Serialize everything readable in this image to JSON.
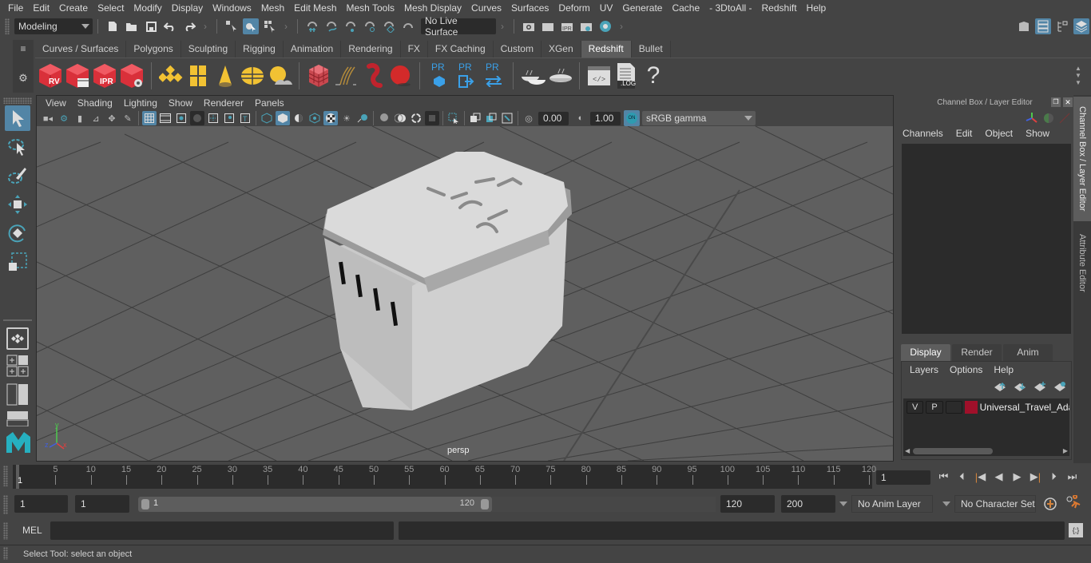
{
  "menubar": {
    "items": [
      "File",
      "Edit",
      "Create",
      "Select",
      "Modify",
      "Display",
      "Windows",
      "Mesh",
      "Edit Mesh",
      "Mesh Tools",
      "Mesh Display",
      "Curves",
      "Surfaces",
      "Deform",
      "UV",
      "Generate",
      "Cache",
      "- 3DtoAll -",
      "Redshift",
      "Help"
    ]
  },
  "statusline": {
    "mode": "Modeling",
    "live_surface": "No Live Surface",
    "icons": [
      "new-scene",
      "open-scene",
      "save-scene",
      "undo",
      "redo",
      "select-by-hierarchy",
      "select-by-object",
      "select-by-component",
      "snap-grid",
      "snap-curve",
      "snap-point",
      "snap-projected-center",
      "snap-view-plane",
      "make-live",
      "render-view",
      "render-current",
      "ipr-render",
      "render-settings",
      "hypershade"
    ],
    "right_icons": [
      "modeling-toolkit",
      "attribute-editor-toggle",
      "tool-settings-toggle",
      "channel-box-toggle"
    ]
  },
  "shelf": {
    "tabs": [
      "Curves / Surfaces",
      "Polygons",
      "Sculpting",
      "Rigging",
      "Animation",
      "Rendering",
      "FX",
      "FX Caching",
      "Custom",
      "XGen",
      "Redshift",
      "Bullet"
    ],
    "active_tab": "Redshift",
    "icons": [
      {
        "name": "redshift-render-view",
        "label": "RV"
      },
      {
        "name": "redshift-batch-render",
        "label": ""
      },
      {
        "name": "redshift-ipr",
        "label": "IPR"
      },
      {
        "name": "redshift-render-settings",
        "label": ""
      },
      {
        "name": "redshift-dome-light",
        "label": ""
      },
      {
        "name": "redshift-area-light",
        "label": ""
      },
      {
        "name": "redshift-spot-light",
        "label": ""
      },
      {
        "name": "redshift-portal-light",
        "label": ""
      },
      {
        "name": "redshift-sun-sky",
        "label": ""
      },
      {
        "name": "redshift-proxy",
        "label": ""
      },
      {
        "name": "redshift-hair",
        "label": ""
      },
      {
        "name": "redshift-volume",
        "label": ""
      },
      {
        "name": "redshift-sphere",
        "label": ""
      },
      {
        "name": "redshift-pr-mesh",
        "label": "PR"
      },
      {
        "name": "redshift-pr-export",
        "label": "PR"
      },
      {
        "name": "redshift-pr-convert",
        "label": "PR"
      },
      {
        "name": "redshift-bake-sets",
        "label": ""
      },
      {
        "name": "redshift-bake",
        "label": ""
      },
      {
        "name": "redshift-script-editor",
        "label": ""
      },
      {
        "name": "redshift-log",
        "label": ".LOG"
      },
      {
        "name": "redshift-help",
        "label": "?"
      }
    ]
  },
  "viewport": {
    "menu": [
      "View",
      "Shading",
      "Lighting",
      "Show",
      "Renderer",
      "Panels"
    ],
    "exposure": "0.00",
    "gamma": "1.00",
    "color_management": "ON",
    "color_space": "sRGB gamma",
    "camera_label": "persp",
    "axis": {
      "x": "x",
      "y": "y",
      "z": "z"
    }
  },
  "channel_box": {
    "title": "Channel Box / Layer Editor",
    "menu": [
      "Channels",
      "Edit",
      "Object",
      "Show"
    ]
  },
  "layer_editor": {
    "tabs": [
      "Display",
      "Render",
      "Anim"
    ],
    "active_tab": "Display",
    "menu": [
      "Layers",
      "Options",
      "Help"
    ],
    "layers": [
      {
        "visible": "V",
        "playback": "P",
        "color": "#a0102a",
        "name": "Universal_Travel_Adapter"
      }
    ]
  },
  "side_tabs": [
    "Channel Box / Layer Editor",
    "Attribute Editor"
  ],
  "timeline": {
    "ticks": [
      5,
      10,
      15,
      20,
      25,
      30,
      35,
      40,
      45,
      50,
      55,
      60,
      65,
      70,
      75,
      80,
      85,
      90,
      95,
      100,
      105,
      110,
      115,
      120
    ],
    "range_min": 1,
    "range_max": 120,
    "current_frame_marker": "1",
    "current_frame": "1"
  },
  "range": {
    "start_field": "1",
    "playback_start": "1",
    "slider_start": "1",
    "slider_end": "120",
    "playback_end": "120",
    "end_field": "200",
    "anim_layer": "No Anim Layer",
    "character_set": "No Character Set"
  },
  "command": {
    "label": "MEL",
    "input": "",
    "output": ""
  },
  "help_line": "Select Tool: select an object"
}
